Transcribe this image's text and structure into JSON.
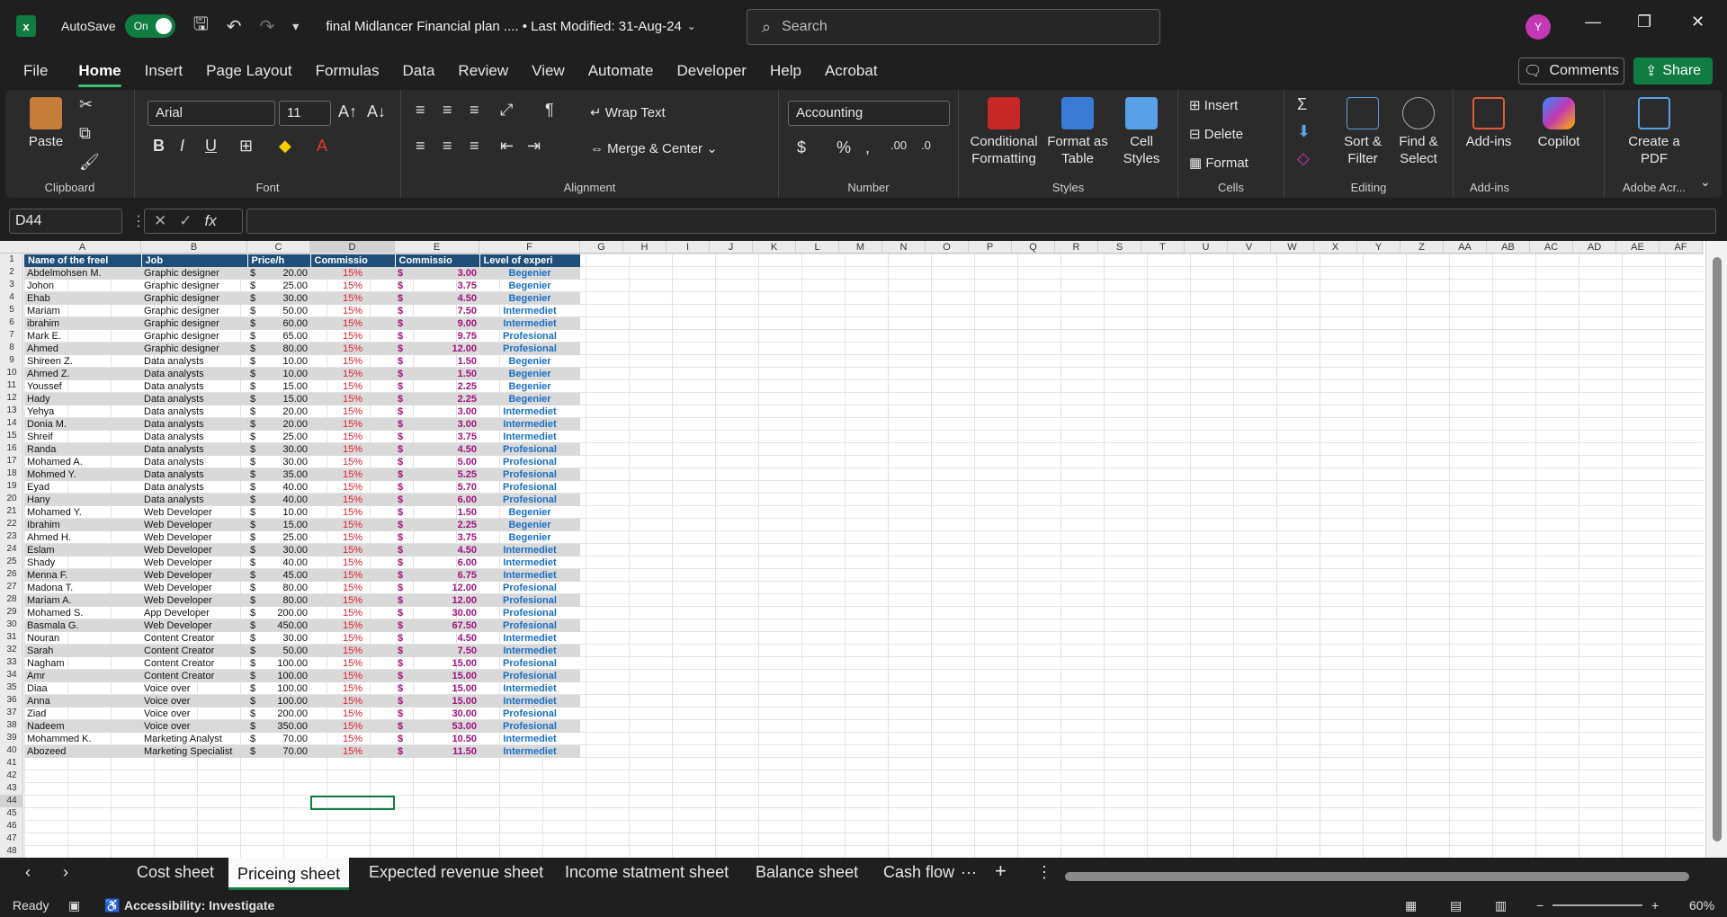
{
  "titlebar": {
    "autosave_label": "AutoSave",
    "autosave_state": "On",
    "doc_title": "final Midlancer Financial plan .... • Last Modified: 31-Aug-24",
    "search_placeholder": "Search",
    "avatar_initial": "Y"
  },
  "menu": {
    "items": [
      "File",
      "Home",
      "Insert",
      "Page Layout",
      "Formulas",
      "Data",
      "Review",
      "View",
      "Automate",
      "Developer",
      "Help",
      "Acrobat"
    ],
    "active": "Home",
    "comments": "Comments",
    "share": "Share"
  },
  "ribbon": {
    "clipboard": {
      "label": "Clipboard",
      "paste": "Paste"
    },
    "font": {
      "label": "Font",
      "family": "Arial",
      "size": "11"
    },
    "alignment": {
      "label": "Alignment",
      "wrap": "Wrap Text",
      "merge": "Merge & Center"
    },
    "number": {
      "label": "Number",
      "format": "Accounting"
    },
    "styles": {
      "label": "Styles",
      "conditional": "Conditional Formatting",
      "format_table": "Format as Table",
      "cell_styles": "Cell Styles"
    },
    "cells": {
      "label": "Cells",
      "insert": "Insert",
      "delete": "Delete",
      "format": "Format"
    },
    "editing": {
      "label": "Editing",
      "sort": "Sort & Filter",
      "find": "Find & Select"
    },
    "addins": {
      "label": "Add-ins",
      "addins": "Add-ins",
      "copilot": "Copilot"
    },
    "acrobat": {
      "label": "Adobe Acr...",
      "create_pdf": "Create a PDF"
    }
  },
  "formula": {
    "namebox": "D44",
    "fx": "fx"
  },
  "columns": [
    "A",
    "B",
    "C",
    "D",
    "E",
    "F",
    "G",
    "H",
    "I",
    "J",
    "K",
    "L",
    "M",
    "N",
    "O",
    "P",
    "Q",
    "R",
    "S",
    "T",
    "U",
    "V",
    "W",
    "X",
    "Y",
    "Z",
    "AA",
    "AB",
    "AC",
    "AD",
    "AE",
    "AF"
  ],
  "table": {
    "headers": [
      "Name of the freel",
      "Job",
      "Price/h",
      "Commissio",
      "Commissio",
      "Level of experi"
    ],
    "rows": [
      [
        "Abdelmohsen M.",
        "Graphic designer",
        "20.00",
        "15%",
        "3.00",
        "Begenier"
      ],
      [
        "Johon",
        "Graphic designer",
        "25.00",
        "15%",
        "3.75",
        "Begenier"
      ],
      [
        "Ehab",
        "Graphic designer",
        "30.00",
        "15%",
        "4.50",
        "Begenier"
      ],
      [
        "Mariam",
        "Graphic designer",
        "50.00",
        "15%",
        "7.50",
        "Intermediet"
      ],
      [
        "ibrahim",
        "Graphic designer",
        "60.00",
        "15%",
        "9.00",
        "Intermediet"
      ],
      [
        "Mark E.",
        "Graphic designer",
        "65.00",
        "15%",
        "9.75",
        "Profesional"
      ],
      [
        "Ahmed",
        "Graphic designer",
        "80.00",
        "15%",
        "12.00",
        "Profesional"
      ],
      [
        "Shireen Z.",
        "Data analysts",
        "10.00",
        "15%",
        "1.50",
        "Begenier"
      ],
      [
        "Ahmed Z.",
        "Data analysts",
        "10.00",
        "15%",
        "1.50",
        "Begenier"
      ],
      [
        "Youssef",
        "Data analysts",
        "15.00",
        "15%",
        "2.25",
        "Begenier"
      ],
      [
        "Hady",
        "Data analysts",
        "15.00",
        "15%",
        "2.25",
        "Begenier"
      ],
      [
        "Yehya",
        "Data analysts",
        "20.00",
        "15%",
        "3.00",
        "Intermediet"
      ],
      [
        "Donia M.",
        "Data analysts",
        "20.00",
        "15%",
        "3.00",
        "Intermediet"
      ],
      [
        "Shreif",
        "Data analysts",
        "25.00",
        "15%",
        "3.75",
        "Intermediet"
      ],
      [
        "Randa",
        "Data analysts",
        "30.00",
        "15%",
        "4.50",
        "Profesional"
      ],
      [
        "Mohamed A.",
        "Data analysts",
        "30.00",
        "15%",
        "5.00",
        "Profesional"
      ],
      [
        "Mohmed Y.",
        "Data analysts",
        "35.00",
        "15%",
        "5.25",
        "Profesional"
      ],
      [
        "Eyad",
        "Data analysts",
        "40.00",
        "15%",
        "5.70",
        "Profesional"
      ],
      [
        "Hany",
        "Data analysts",
        "40.00",
        "15%",
        "6.00",
        "Profesional"
      ],
      [
        " Mohamed Y.",
        "Web Developer",
        "10.00",
        "15%",
        "1.50",
        "Begenier"
      ],
      [
        "Ibrahim",
        "Web Developer",
        "15.00",
        "15%",
        "2.25",
        "Begenier"
      ],
      [
        "Ahmed H.",
        "Web Developer",
        "25.00",
        "15%",
        "3.75",
        "Begenier"
      ],
      [
        "Eslam",
        "Web Developer",
        "30.00",
        "15%",
        "4.50",
        "Intermediet"
      ],
      [
        "Shady",
        "Web Developer",
        "40.00",
        "15%",
        "6.00",
        "Intermediet"
      ],
      [
        "Menna F.",
        "Web Developer",
        "45.00",
        "15%",
        "6.75",
        "Intermediet"
      ],
      [
        "Madona T.",
        "Web Developer",
        "80.00",
        "15%",
        "12.00",
        "Profesional"
      ],
      [
        "Mariam A.",
        "Web Developer",
        "80.00",
        "15%",
        "12.00",
        "Profesional"
      ],
      [
        "Mohamed S.",
        "App Developer",
        "200.00",
        "15%",
        "30.00",
        "Profesional"
      ],
      [
        "Basmala G.",
        "Web Developer",
        "450.00",
        "15%",
        "67.50",
        "Profesional"
      ],
      [
        "Nouran",
        "Content Creator",
        "30.00",
        "15%",
        "4.50",
        "Intermediet"
      ],
      [
        "Sarah",
        "Content Creator",
        "50.00",
        "15%",
        "7.50",
        "Intermediet"
      ],
      [
        "Nagham",
        "Content Creator",
        "100.00",
        "15%",
        "15.00",
        "Profesional"
      ],
      [
        "Amr",
        "Content Creator",
        "100.00",
        "15%",
        "15.00",
        "Profesional"
      ],
      [
        "Diaa",
        "Voice over",
        "100.00",
        "15%",
        "15.00",
        "Intermediet"
      ],
      [
        "Anna",
        "Voice over",
        "100.00",
        "15%",
        "15.00",
        "Intermediet"
      ],
      [
        "Ziad",
        "Voice over",
        "200.00",
        "15%",
        "30.00",
        "Profesional"
      ],
      [
        "Nadeem",
        "Voice over",
        "350.00",
        "15%",
        "53.00",
        "Profesional"
      ],
      [
        "Mohammed K.",
        "Marketing Analyst",
        "70.00",
        "15%",
        "10.50",
        "Intermediet"
      ],
      [
        "Abozeed",
        "Marketing Specialist",
        "70.00",
        "15%",
        "11.50",
        "Intermediet"
      ]
    ],
    "currency": "$"
  },
  "sheets": {
    "tabs": [
      "Cost sheet",
      "Priceing sheet",
      "Expected revenue sheet",
      "Income statment sheet",
      "Balance sheet",
      "Cash flow"
    ],
    "active": "Priceing sheet",
    "more": "···"
  },
  "status": {
    "ready": "Ready",
    "accessibility": "Accessibility: Investigate",
    "zoom": "60%"
  }
}
